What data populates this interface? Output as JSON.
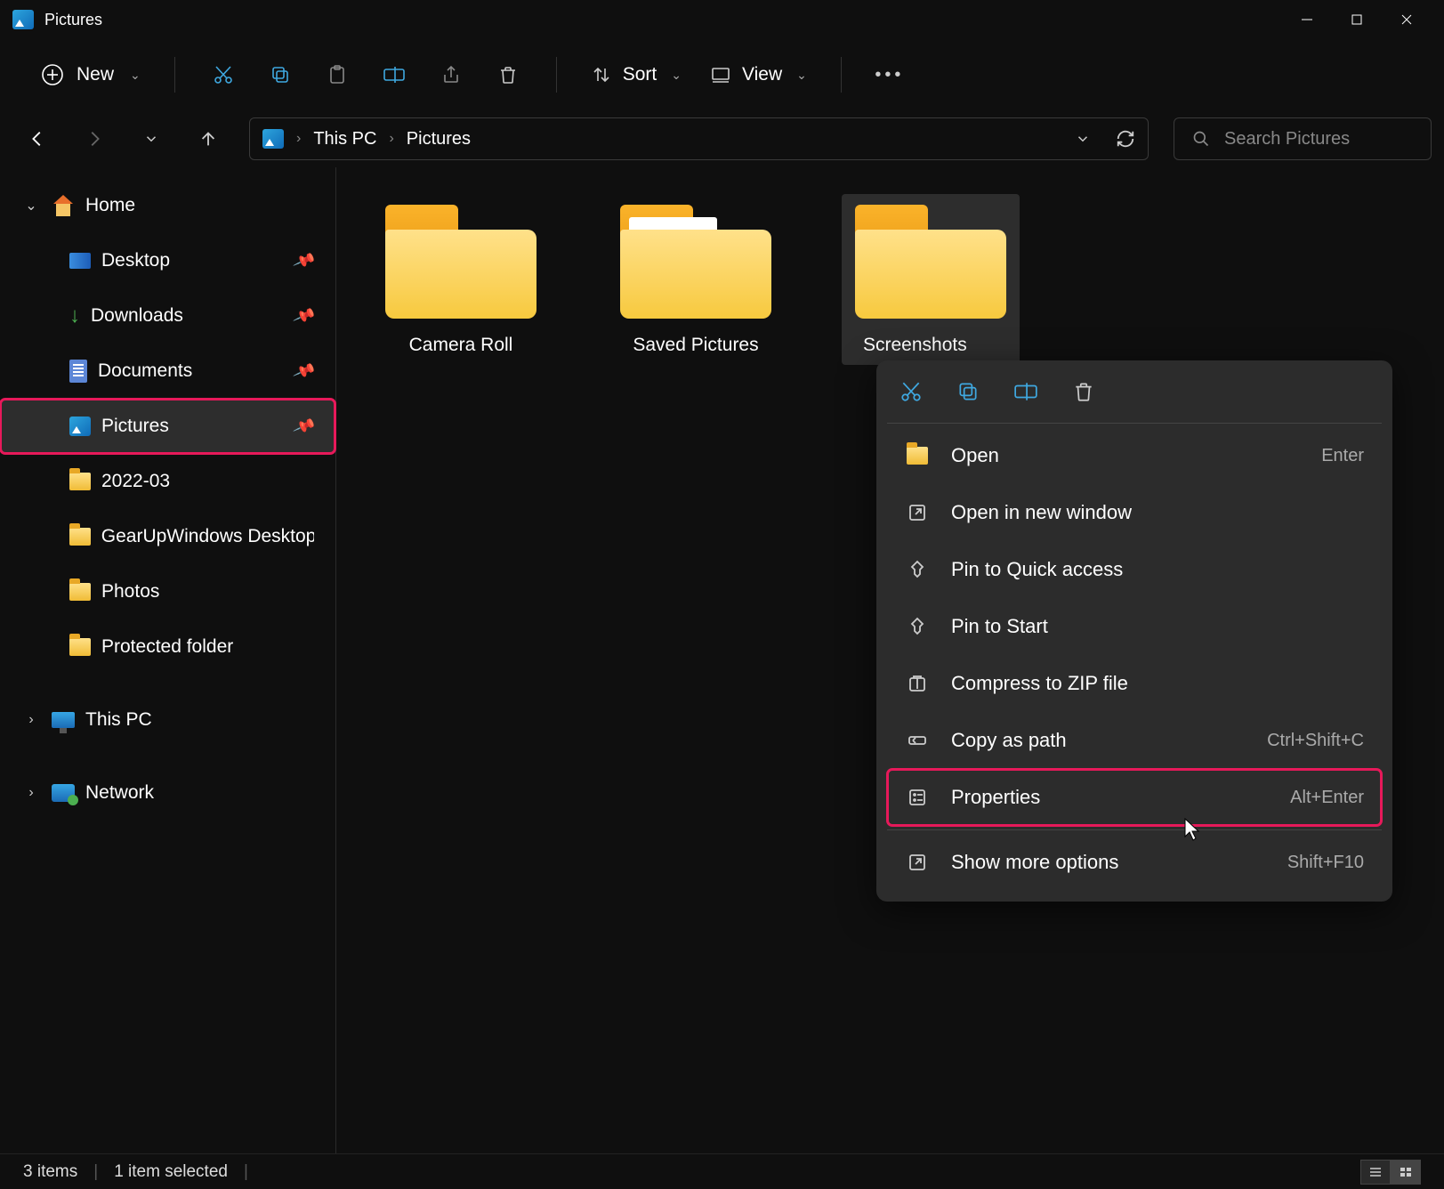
{
  "window": {
    "title": "Pictures"
  },
  "toolbar": {
    "new": "New",
    "sort": "Sort",
    "view": "View",
    "icons": {
      "new": "plus-circle-icon",
      "cut": "cut-icon",
      "copy": "copy-icon",
      "paste": "paste-icon",
      "rename": "rename-icon",
      "share": "share-icon",
      "delete": "delete-icon",
      "sort": "sort-icon",
      "view": "view-icon",
      "more": "more-icon"
    }
  },
  "breadcrumb": {
    "segments": [
      "This PC",
      "Pictures"
    ]
  },
  "search": {
    "placeholder": "Search Pictures"
  },
  "sidebar": {
    "home": "Home",
    "quick": [
      {
        "label": "Desktop",
        "pinned": true,
        "icon": "desktop"
      },
      {
        "label": "Downloads",
        "pinned": true,
        "icon": "download"
      },
      {
        "label": "Documents",
        "pinned": true,
        "icon": "doc"
      },
      {
        "label": "Pictures",
        "pinned": true,
        "icon": "pic",
        "active": true
      },
      {
        "label": "2022-03",
        "pinned": false,
        "icon": "folder"
      },
      {
        "label": "GearUpWindows Desktop",
        "pinned": false,
        "icon": "folder"
      },
      {
        "label": "Photos",
        "pinned": false,
        "icon": "folder"
      },
      {
        "label": "Protected folder",
        "pinned": false,
        "icon": "folder"
      }
    ],
    "this_pc": "This PC",
    "network": "Network"
  },
  "folders": [
    {
      "label": "Camera Roll",
      "selected": false,
      "paper": false
    },
    {
      "label": "Saved Pictures",
      "selected": false,
      "paper": true
    },
    {
      "label": "Screenshots",
      "selected": true,
      "paper": false
    }
  ],
  "context_menu": {
    "items": [
      {
        "label": "Open",
        "shortcut": "Enter",
        "icon": "folder-open"
      },
      {
        "label": "Open in new window",
        "shortcut": "",
        "icon": "new-window"
      },
      {
        "label": "Pin to Quick access",
        "shortcut": "",
        "icon": "pin"
      },
      {
        "label": "Pin to Start",
        "shortcut": "",
        "icon": "pin"
      },
      {
        "label": "Compress to ZIP file",
        "shortcut": "",
        "icon": "zip"
      },
      {
        "label": "Copy as path",
        "shortcut": "Ctrl+Shift+C",
        "icon": "path"
      },
      {
        "label": "Properties",
        "shortcut": "Alt+Enter",
        "icon": "properties",
        "highlight": true
      },
      {
        "label": "Show more options",
        "shortcut": "Shift+F10",
        "icon": "more-square"
      }
    ]
  },
  "statusbar": {
    "count": "3 items",
    "selected": "1 item selected"
  }
}
